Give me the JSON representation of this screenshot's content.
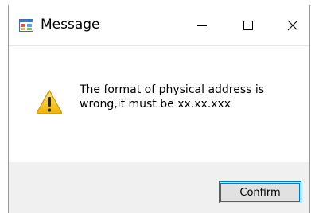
{
  "window": {
    "title": "Message",
    "app_icon": "app-window-icon",
    "controls": {
      "minimize_icon": "minimize-icon",
      "maximize_icon": "maximize-icon",
      "close_icon": "close-icon"
    }
  },
  "message": {
    "icon": "warning-icon",
    "text": "The format of physical address is wrong,it must be xx.xx.xxx"
  },
  "buttons": {
    "confirm_label": "Confirm"
  },
  "colors": {
    "accent": "#0078d7",
    "footer_bg": "#f0f0f0",
    "warning_yellow": "#f6c31c"
  }
}
